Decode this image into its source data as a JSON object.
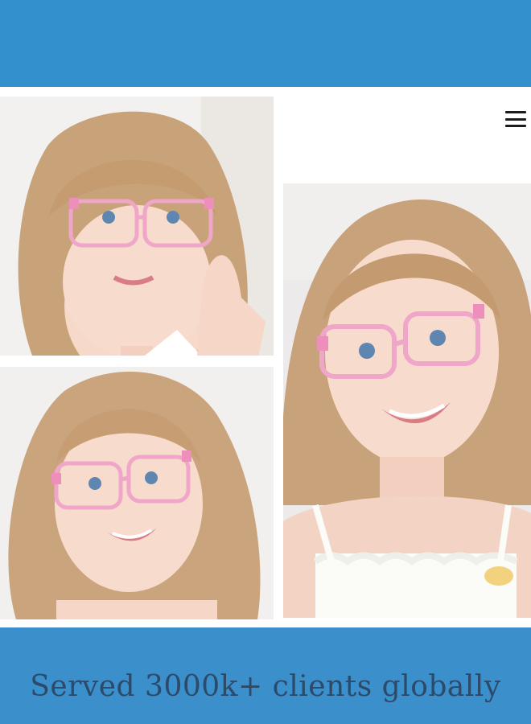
{
  "header": {
    "menu_icon": "hamburger-menu-icon"
  },
  "gallery": {
    "photos": [
      {
        "name": "girl-adjusting-pink-glasses"
      },
      {
        "name": "girl-smiling-pink-glasses"
      },
      {
        "name": "girl-close-up-pink-glasses"
      }
    ]
  },
  "footer": {
    "tagline": "Served 3000k+ clients globally"
  },
  "colors": {
    "band": "#3490cc",
    "tagline_text": "#2c4a6a",
    "frame_pink": "#f0a6c8"
  }
}
